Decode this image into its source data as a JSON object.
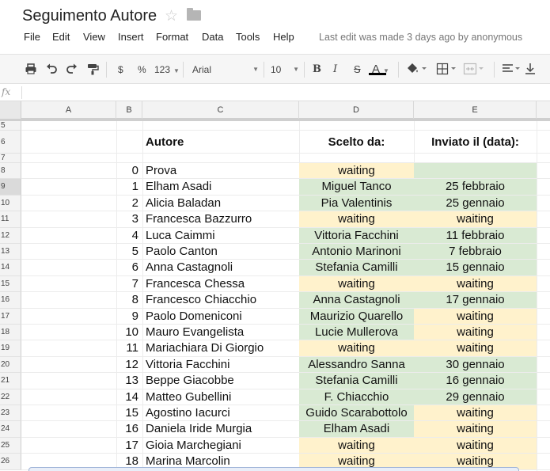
{
  "title": "Seguimento Autore",
  "menu": [
    "File",
    "Edit",
    "View",
    "Insert",
    "Format",
    "Data",
    "Tools",
    "Help"
  ],
  "last_edit": "Last edit was made 3 days ago by anonymous",
  "toolbar": {
    "currency": "$",
    "percent": "%",
    "number_format": "123",
    "font": "Arial",
    "font_size": "10",
    "bold": "B",
    "italic": "I",
    "strike": "S",
    "text_color": "A"
  },
  "formula_icon": "fx",
  "columns": [
    "A",
    "B",
    "C",
    "D",
    "E"
  ],
  "header_row": {
    "row_num": "6",
    "author": "Autore",
    "chosen_by": "Scelto da:",
    "sent_date": "Inviato il (data):"
  },
  "colors": {
    "green": "#d9ead3",
    "yellow": "#fff2cc"
  },
  "rows": [
    {
      "row": "5",
      "num": "",
      "author": "",
      "chosen": "",
      "sent": "",
      "dfill": "",
      "efill": ""
    },
    {
      "row": "6",
      "header": true
    },
    {
      "row": "7",
      "num": "",
      "author": "",
      "chosen": "",
      "sent": "",
      "dfill": "",
      "efill": ""
    },
    {
      "row": "8",
      "num": "0",
      "author": "Prova",
      "chosen": "waiting",
      "sent": "",
      "dfill": "yellow",
      "efill": "green"
    },
    {
      "row": "9",
      "num": "1",
      "author": "Elham Asadi",
      "chosen": "Miguel Tanco",
      "sent": "25 febbraio",
      "dfill": "green",
      "efill": "green",
      "selected": true
    },
    {
      "row": "10",
      "num": "2",
      "author": "Alicia Baladan",
      "chosen": "Pia Valentinis",
      "sent": "25 gennaio",
      "dfill": "green",
      "efill": "green"
    },
    {
      "row": "11",
      "num": "3",
      "author": "Francesca Bazzurro",
      "chosen": "waiting",
      "sent": "waiting",
      "dfill": "yellow",
      "efill": "yellow"
    },
    {
      "row": "12",
      "num": "4",
      "author": "Luca Caimmi",
      "chosen": "Vittoria Facchini",
      "sent": "11 febbraio",
      "dfill": "green",
      "efill": "green"
    },
    {
      "row": "13",
      "num": "5",
      "author": "Paolo Canton",
      "chosen": "Antonio Marinoni",
      "sent": "7 febbraio",
      "dfill": "green",
      "efill": "green"
    },
    {
      "row": "14",
      "num": "6",
      "author": "Anna Castagnoli",
      "chosen": "Stefania Camilli",
      "sent": "15 gennaio",
      "dfill": "green",
      "efill": "green"
    },
    {
      "row": "15",
      "num": "7",
      "author": "Francesca Chessa",
      "chosen": "waiting",
      "sent": "waiting",
      "dfill": "yellow",
      "efill": "yellow"
    },
    {
      "row": "16",
      "num": "8",
      "author": "Francesco Chiacchio",
      "chosen": "Anna Castagnoli",
      "sent": "17 gennaio",
      "dfill": "green",
      "efill": "green"
    },
    {
      "row": "17",
      "num": "9",
      "author": "Paolo Domeniconi",
      "chosen": "Maurizio Quarello",
      "sent": "waiting",
      "dfill": "green",
      "efill": "yellow"
    },
    {
      "row": "18",
      "num": "10",
      "author": "Mauro Evangelista",
      "chosen": "Lucie Mullerova",
      "sent": "waiting",
      "dfill": "green",
      "efill": "yellow"
    },
    {
      "row": "19",
      "num": "11",
      "author": "Mariachiara Di Giorgio",
      "chosen": "waiting",
      "sent": "waiting",
      "dfill": "yellow",
      "efill": "yellow"
    },
    {
      "row": "20",
      "num": "12",
      "author": "Vittoria Facchini",
      "chosen": "Alessandro Sanna",
      "sent": "30 gennaio",
      "dfill": "green",
      "efill": "green"
    },
    {
      "row": "21",
      "num": "13",
      "author": "Beppe Giacobbe",
      "chosen": "Stefania Camilli",
      "sent": "16 gennaio",
      "dfill": "green",
      "efill": "green"
    },
    {
      "row": "22",
      "num": "14",
      "author": "Matteo Gubellini",
      "chosen": "F. Chiacchio",
      "sent": "29 gennaio",
      "dfill": "green",
      "efill": "green"
    },
    {
      "row": "23",
      "num": "15",
      "author": "Agostino Iacurci",
      "chosen": "Guido Scarabottolo",
      "sent": "waiting",
      "dfill": "green",
      "efill": "yellow"
    },
    {
      "row": "24",
      "num": "16",
      "author": "Daniela Iride Murgia",
      "chosen": "Elham Asadi",
      "sent": "waiting",
      "dfill": "green",
      "efill": "yellow"
    },
    {
      "row": "25",
      "num": "17",
      "author": "Gioia Marchegiani",
      "chosen": "waiting",
      "sent": "waiting",
      "dfill": "yellow",
      "efill": "yellow"
    },
    {
      "row": "26",
      "num": "18",
      "author": "Marina Marcolin",
      "chosen": "waiting",
      "sent": "waiting",
      "dfill": "yellow",
      "efill": "yellow"
    }
  ]
}
